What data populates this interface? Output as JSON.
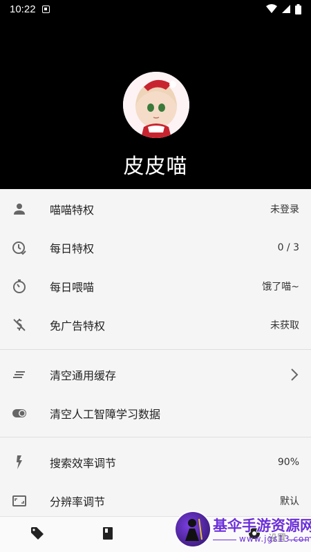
{
  "status_bar": {
    "time": "10:22",
    "icons": [
      "notification-icon",
      "wifi-icon",
      "signal-icon",
      "battery-icon"
    ]
  },
  "profile": {
    "name": "皮皮喵",
    "avatar": "avatar-image"
  },
  "menu": {
    "items": [
      {
        "label": "喵喵特权",
        "value": "未登录",
        "icon": "person-icon"
      },
      {
        "label": "每日特权",
        "value": "0 / 3",
        "icon": "clock-check-icon"
      },
      {
        "label": "每日喂喵",
        "value": "饿了喵~",
        "icon": "timer-icon"
      },
      {
        "label": "免广告特权",
        "value": "未获取",
        "icon": "money-off-icon"
      },
      {
        "label": "清空通用缓存",
        "value": "",
        "icon": "lines-icon"
      },
      {
        "label": "清空人工智障学习数据",
        "value": "",
        "icon": "toggle-dot-icon"
      },
      {
        "label": "搜索效率调节",
        "value": "90%",
        "icon": "flash-icon"
      },
      {
        "label": "分辨率调节",
        "value": "默认",
        "icon": "aspect-ratio-icon"
      }
    ]
  },
  "bottom_nav": {
    "items": [
      "tag-icon",
      "book-icon",
      "settings-icon"
    ],
    "active_label": "设置"
  },
  "watermark": {
    "title": "基伞手游资源网",
    "url": "www.jgs13.com"
  },
  "colors": {
    "header_bg": "#000000",
    "page_bg": "#f5f5f5",
    "watermark": "#6b2fd8"
  }
}
